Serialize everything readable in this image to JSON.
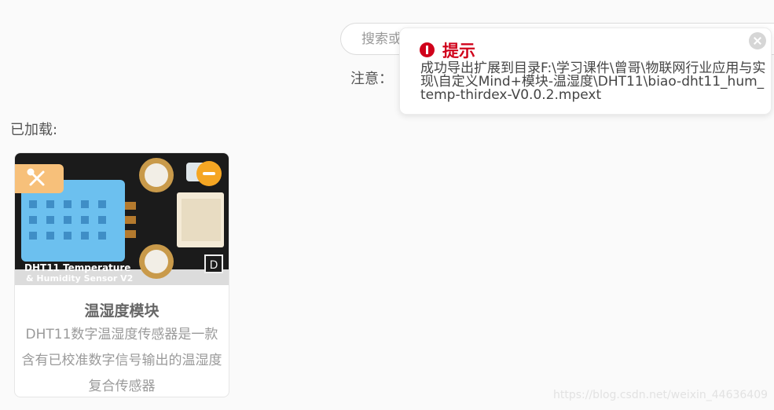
{
  "search": {
    "placeholder": "搜索或"
  },
  "note": {
    "label": "注意："
  },
  "loaded": {
    "label": "已加载:"
  },
  "card": {
    "title": "温湿度模块",
    "description": "DHT11数字温湿度传感器是一款含有已校准数字信号输出的温湿度复合传感器",
    "image_caption_line1": "DHT11 Temperature",
    "image_caption_line2": "& Humidity Sensor V2",
    "pin_label": "D"
  },
  "toast": {
    "title": "提示",
    "message": "成功导出扩展到目录F:\\学习课件\\曾哥\\物联网行业应用与实现\\自定义Mind+模块-温湿度\\DHT11\\biao-dht11_hum_temp-thirdex-V0.0.2.mpext",
    "accent_color": "#d0021b"
  },
  "watermark": "https://blog.csdn.net/weixin_44636409",
  "icons": {
    "badge": "wrench-screwdriver-icon",
    "remove": "minus-circle-icon",
    "close": "close-icon",
    "alert": "exclamation-circle-icon"
  }
}
